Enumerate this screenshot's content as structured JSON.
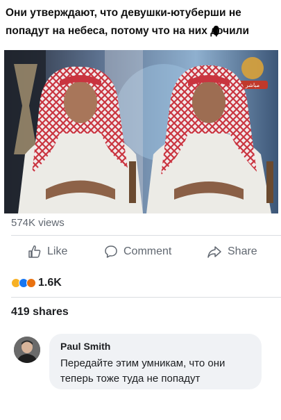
{
  "caption": {
    "line1": "Они утверждают, что девушки-ютуберши не",
    "line2_before": "попадут на небеса, потому что на них д",
    "line2_after": "очили"
  },
  "video": {
    "logo_text": "مباشر"
  },
  "post": {
    "views": "574K views",
    "actions": {
      "like_label": "Like",
      "comment_label": "Comment",
      "share_label": "Share"
    },
    "reactions": {
      "count": "1.6K",
      "icons": [
        "haha-icon",
        "like-icon",
        "angry-icon"
      ]
    },
    "shares": "419 shares"
  },
  "comment": {
    "author": "Paul Smith",
    "line1": "Передайте этим умникам, что они",
    "line2": "теперь тоже туда не попадут"
  },
  "colors": {
    "secondary_text": "#606770",
    "primary_text": "#1c1e21",
    "bubble_bg": "#f0f2f5",
    "like_blue": "#1877f2",
    "haha_yellow": "#f7b125",
    "angry_orange": "#e9710f"
  }
}
